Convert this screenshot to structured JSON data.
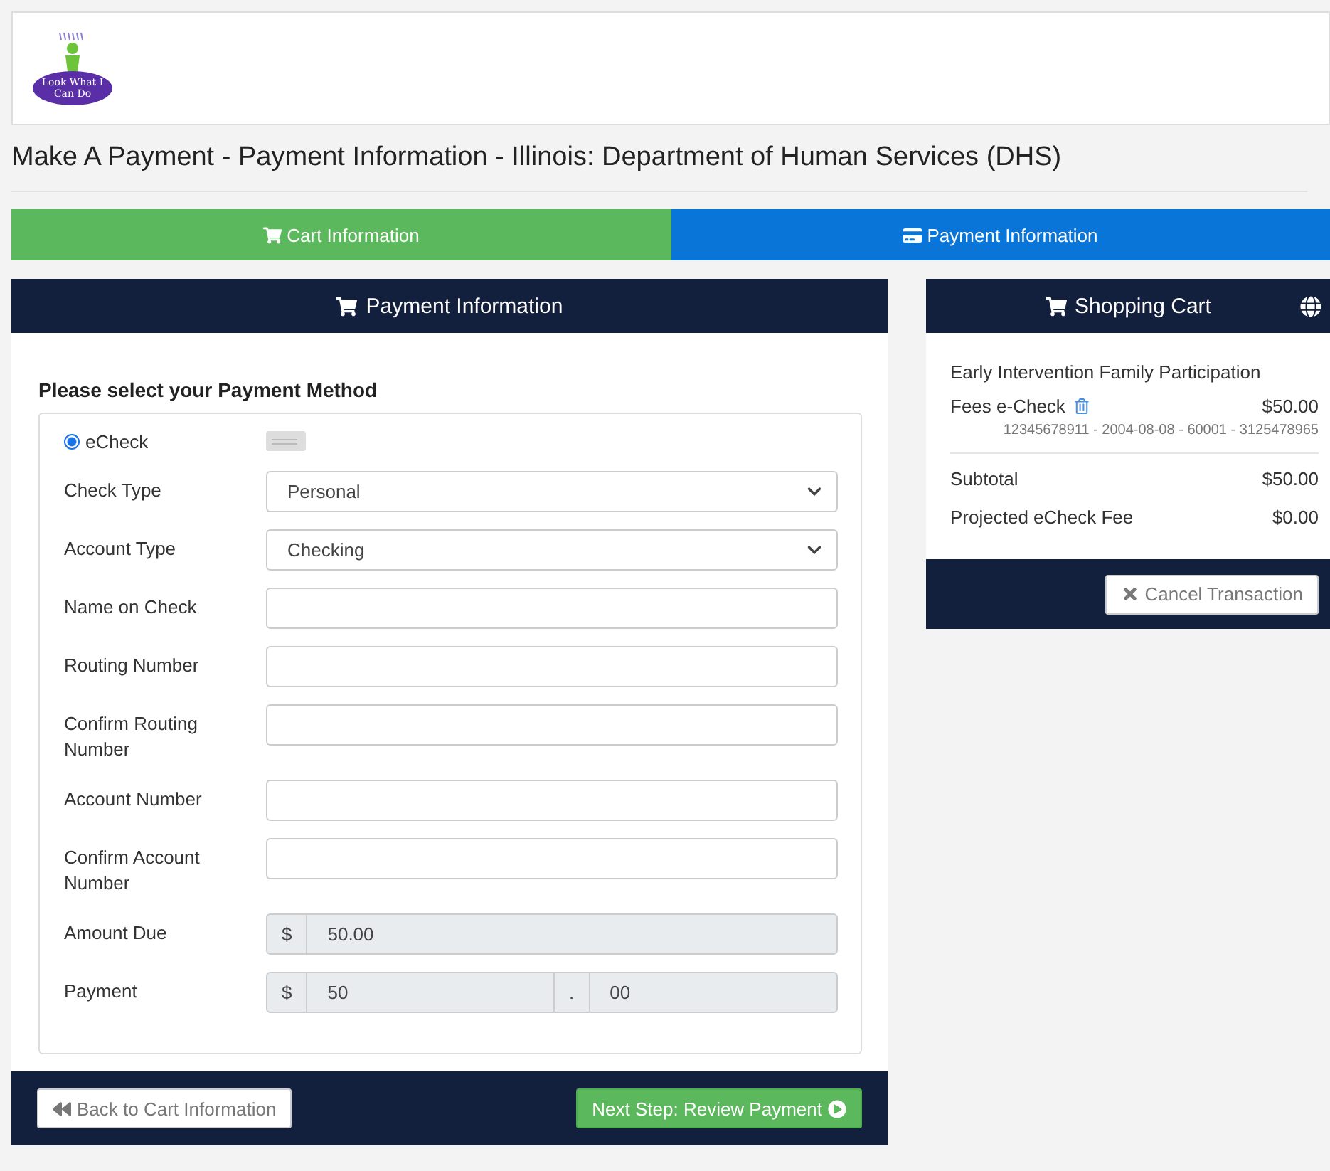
{
  "logo": {
    "text": "Look What I Can Do"
  },
  "page_title": "Make A Payment - Payment Information - Illinois: Department of Human Services (DHS)",
  "steps": [
    {
      "label": "Cart Information",
      "selected": false
    },
    {
      "label": "Payment Information",
      "selected": true
    }
  ],
  "payment_panel": {
    "title": "Payment Information",
    "prompt": "Please select your Payment Method",
    "method": {
      "label": "eCheck",
      "selected": true
    },
    "fields": [
      {
        "kind": "select",
        "label": "Check Type",
        "value": "Personal"
      },
      {
        "kind": "select",
        "label": "Account Type",
        "value": "Checking"
      },
      {
        "kind": "input",
        "label": "Name on Check"
      },
      {
        "kind": "input",
        "label": "Routing Number"
      },
      {
        "kind": "input",
        "label": "Confirm Routing Number"
      },
      {
        "kind": "input",
        "label": "Account Number"
      },
      {
        "kind": "input",
        "label": "Confirm Account Number"
      },
      {
        "kind": "amount",
        "label": "Amount Due",
        "prefix": "$",
        "value": "50.00"
      },
      {
        "kind": "split",
        "label": "Payment",
        "prefix": "$",
        "value": "50",
        "separator": ".",
        "cents": "00"
      }
    ],
    "back_button": "Back to Cart Information",
    "next_button": "Next Step: Review Payment"
  },
  "cart_panel": {
    "title": "Shopping Cart",
    "item_group": "Early Intervention Family Participation",
    "items": [
      {
        "name": "Fees e-Check",
        "amount": "$50.00",
        "detail": "12345678911 - 2004-08-08 - 60001 - 3125478965"
      }
    ],
    "totals": [
      {
        "label": "Subtotal",
        "amount": "$50.00"
      },
      {
        "label": "Projected eCheck Fee",
        "amount": "$0.00"
      }
    ],
    "cancel_button": "Cancel Transaction"
  }
}
